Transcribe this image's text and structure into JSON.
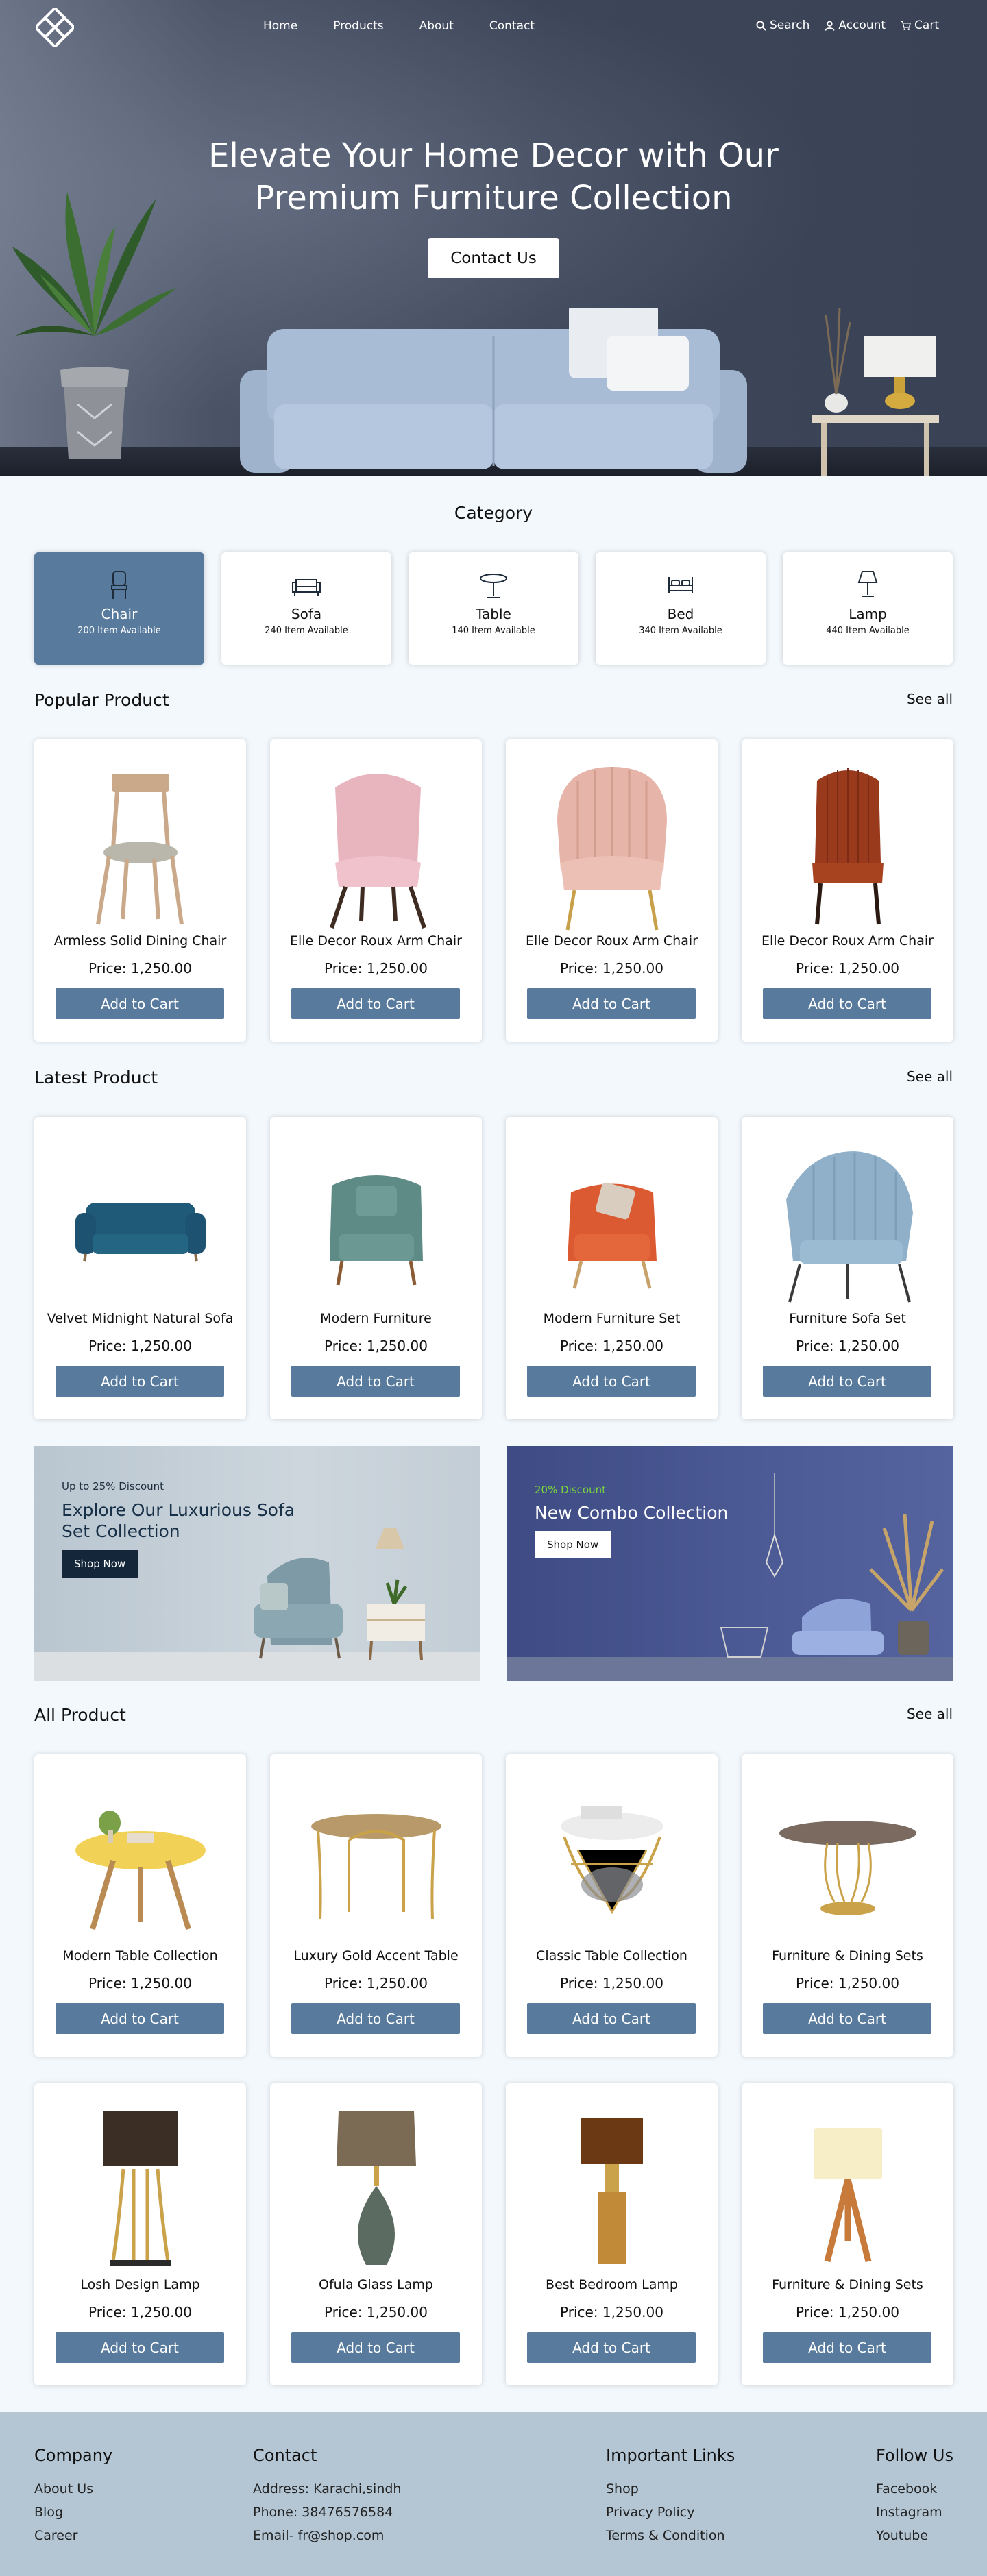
{
  "nav": {
    "links": [
      "Home",
      "Products",
      "About",
      "Contact"
    ],
    "search": "Search",
    "account": "Account",
    "cart": "Cart"
  },
  "hero": {
    "title_line1": "Elevate Your Home Decor with Our",
    "title_line2": "Premium Furniture Collection",
    "cta": "Contact Us"
  },
  "category": {
    "heading": "Category",
    "items": [
      {
        "name": "Chair",
        "count": "200 Item Available",
        "icon": "chair-icon"
      },
      {
        "name": "Sofa",
        "count": "240 Item Available",
        "icon": "sofa-icon"
      },
      {
        "name": "Table",
        "count": "140 Item Available",
        "icon": "table-icon"
      },
      {
        "name": "Bed",
        "count": "340 Item Available",
        "icon": "bed-icon"
      },
      {
        "name": "Lamp",
        "count": "440 Item Available",
        "icon": "lamp-icon"
      }
    ]
  },
  "popular": {
    "title": "Popular Product",
    "see_all": "See all",
    "items": [
      {
        "name": "Armless Solid Dining Chair",
        "price": "Price: 1,250.00",
        "button": "Add to Cart"
      },
      {
        "name": "Elle Decor Roux Arm Chair",
        "price": "Price: 1,250.00",
        "button": "Add to Cart"
      },
      {
        "name": "Elle Decor Roux Arm Chair",
        "price": "Price: 1,250.00",
        "button": "Add to Cart"
      },
      {
        "name": "Elle Decor Roux Arm Chair",
        "price": "Price: 1,250.00",
        "button": "Add to Cart"
      }
    ]
  },
  "latest": {
    "title": "Latest Product",
    "see_all": "See all",
    "items": [
      {
        "name": "Velvet Midnight Natural Sofa",
        "price": "Price: 1,250.00",
        "button": "Add to Cart"
      },
      {
        "name": "Modern Furniture",
        "price": "Price: 1,250.00",
        "button": "Add to Cart"
      },
      {
        "name": "Modern Furniture Set",
        "price": "Price: 1,250.00",
        "button": "Add to Cart"
      },
      {
        "name": "Furniture Sofa  Set",
        "price": "Price: 1,250.00",
        "button": "Add to Cart"
      }
    ]
  },
  "banners": {
    "left": {
      "discount": "Up to 25% Discount",
      "title_line1": "Explore Our Luxurious Sofa",
      "title_line2": "Set Collection",
      "button": "Shop Now"
    },
    "right": {
      "discount": "20% Discount",
      "title": "New Combo Collection",
      "button": "Shop Now"
    }
  },
  "all": {
    "title": "All Product",
    "see_all": "See all",
    "row1": [
      {
        "name": "Modern Table Collection",
        "price": "Price: 1,250.00",
        "button": "Add to Cart"
      },
      {
        "name": "Luxury Gold Accent Table",
        "price": "Price: 1,250.00",
        "button": "Add to Cart"
      },
      {
        "name": "Classic Table Collection",
        "price": "Price: 1,250.00",
        "button": "Add to Cart"
      },
      {
        "name": "Furniture & Dining Sets",
        "price": "Price: 1,250.00",
        "button": "Add to Cart"
      }
    ],
    "row2": [
      {
        "name": "Losh Design Lamp",
        "price": "Price: 1,250.00",
        "button": "Add to Cart"
      },
      {
        "name": "Ofula Glass Lamp",
        "price": "Price: 1,250.00",
        "button": "Add to Cart"
      },
      {
        "name": "Best Bedroom Lamp",
        "price": "Price: 1,250.00",
        "button": "Add to Cart"
      },
      {
        "name": "Furniture & Dining Sets",
        "price": "Price: 1,250.00",
        "button": "Add to Cart"
      }
    ]
  },
  "footer": {
    "company": {
      "heading": "Company",
      "items": [
        "About Us",
        "Blog",
        "Career"
      ]
    },
    "contact": {
      "heading": "Contact",
      "items": [
        "Address: Karachi,sindh",
        "Phone: 38476576584",
        "Email- fr@shop.com"
      ]
    },
    "links": {
      "heading": "Important Links",
      "items": [
        "Shop",
        "Privacy Policy",
        "Terms & Condition"
      ]
    },
    "follow": {
      "heading": "Follow Us",
      "items": [
        "Facebook",
        "Instagram",
        "Youtube"
      ]
    }
  },
  "colors": {
    "accent": "#587b9d",
    "footer": "#b4c6d4",
    "background": "#f3f8fc",
    "discount_green": "#7bd63a"
  }
}
